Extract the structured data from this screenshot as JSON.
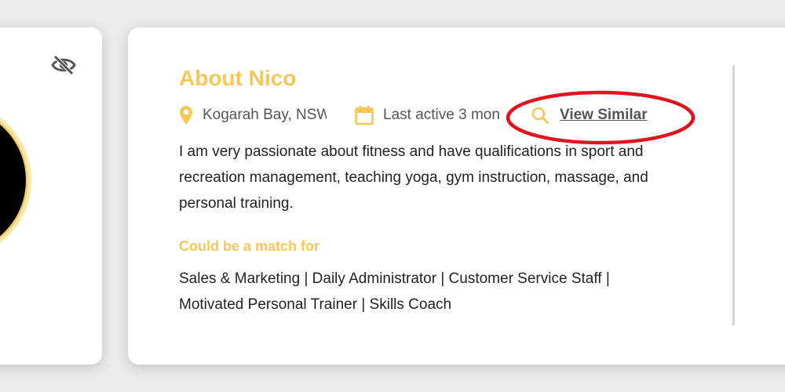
{
  "left_card": {
    "hide_icon": "eye-slash-icon"
  },
  "profile": {
    "title": "About Nico",
    "location": "Kogarah Bay, NSW",
    "last_active": "Last active 3 mon",
    "view_similar_label": "View Similar",
    "description": "I am very passionate about fitness and have qualifications in sport and recreation management, teaching yoga, gym instruction, massage, and personal training.",
    "match_heading": "Could be a match for",
    "match_roles": "Sales & Marketing | Daily Administrator | Customer Service Staff | Motivated Personal Trainer | Skills Coach"
  },
  "colors": {
    "accent": "#f6c756",
    "annotation": "#e0141e",
    "text": "#222222",
    "muted": "#555555"
  },
  "icons": {
    "location": "map-pin-icon",
    "calendar": "calendar-icon",
    "search": "search-icon"
  }
}
